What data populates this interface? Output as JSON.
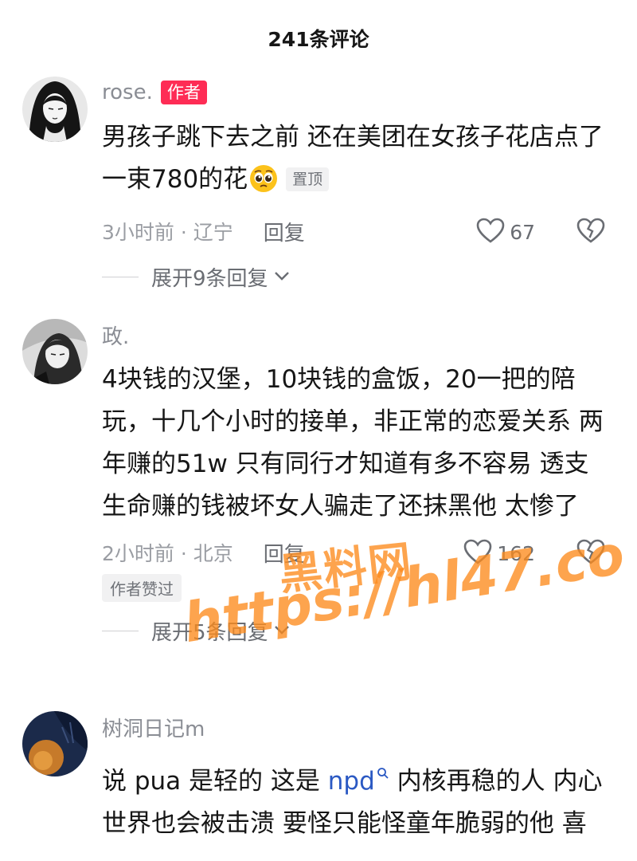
{
  "header": {
    "title": "241条评论"
  },
  "comments": [
    {
      "username": "rose.",
      "author_badge": "作者",
      "text": "男孩子跳下去之前 还在美团在女孩子花店点了一束780的花",
      "emoji": "pleading-face-emoji",
      "pin_tag": "置顶",
      "time_location": "3小时前 · 辽宁",
      "reply_label": "回复",
      "likes": "67",
      "expand_label": "展开9条回复"
    },
    {
      "username": "政.",
      "text": "4块钱的汉堡，10块钱的盒饭，20一把的陪玩，十几个小时的接单，非正常的恋爱关系 两年赚的51w 只有同行才知道有多不容易 透支生命赚的钱被坏女人骗走了还抹黑他 太惨了",
      "time_location": "2小时前 · 北京",
      "reply_label": "回复",
      "likes": "162",
      "author_liked": "作者赞过",
      "expand_label": "展开5条回复"
    },
    {
      "username": "树洞日记m",
      "text_before": "说 pua 是轻的  这是 ",
      "link": "npd",
      "text_after": "  内核再稳的人 内心世界也会被击溃   要怪只能怪童年脆弱的他 喜欢上了她"
    }
  ],
  "watermark": {
    "line1": "黑料网",
    "line2": "https://hl47.co"
  },
  "icons": {
    "like": "heart-outline-icon",
    "dislike": "broken-heart-icon",
    "expand": "chevron-down-icon",
    "search": "search-icon"
  },
  "colors": {
    "author_badge": "#fe2c55",
    "link": "#2b59c3",
    "watermark": "#fc8a1c"
  }
}
